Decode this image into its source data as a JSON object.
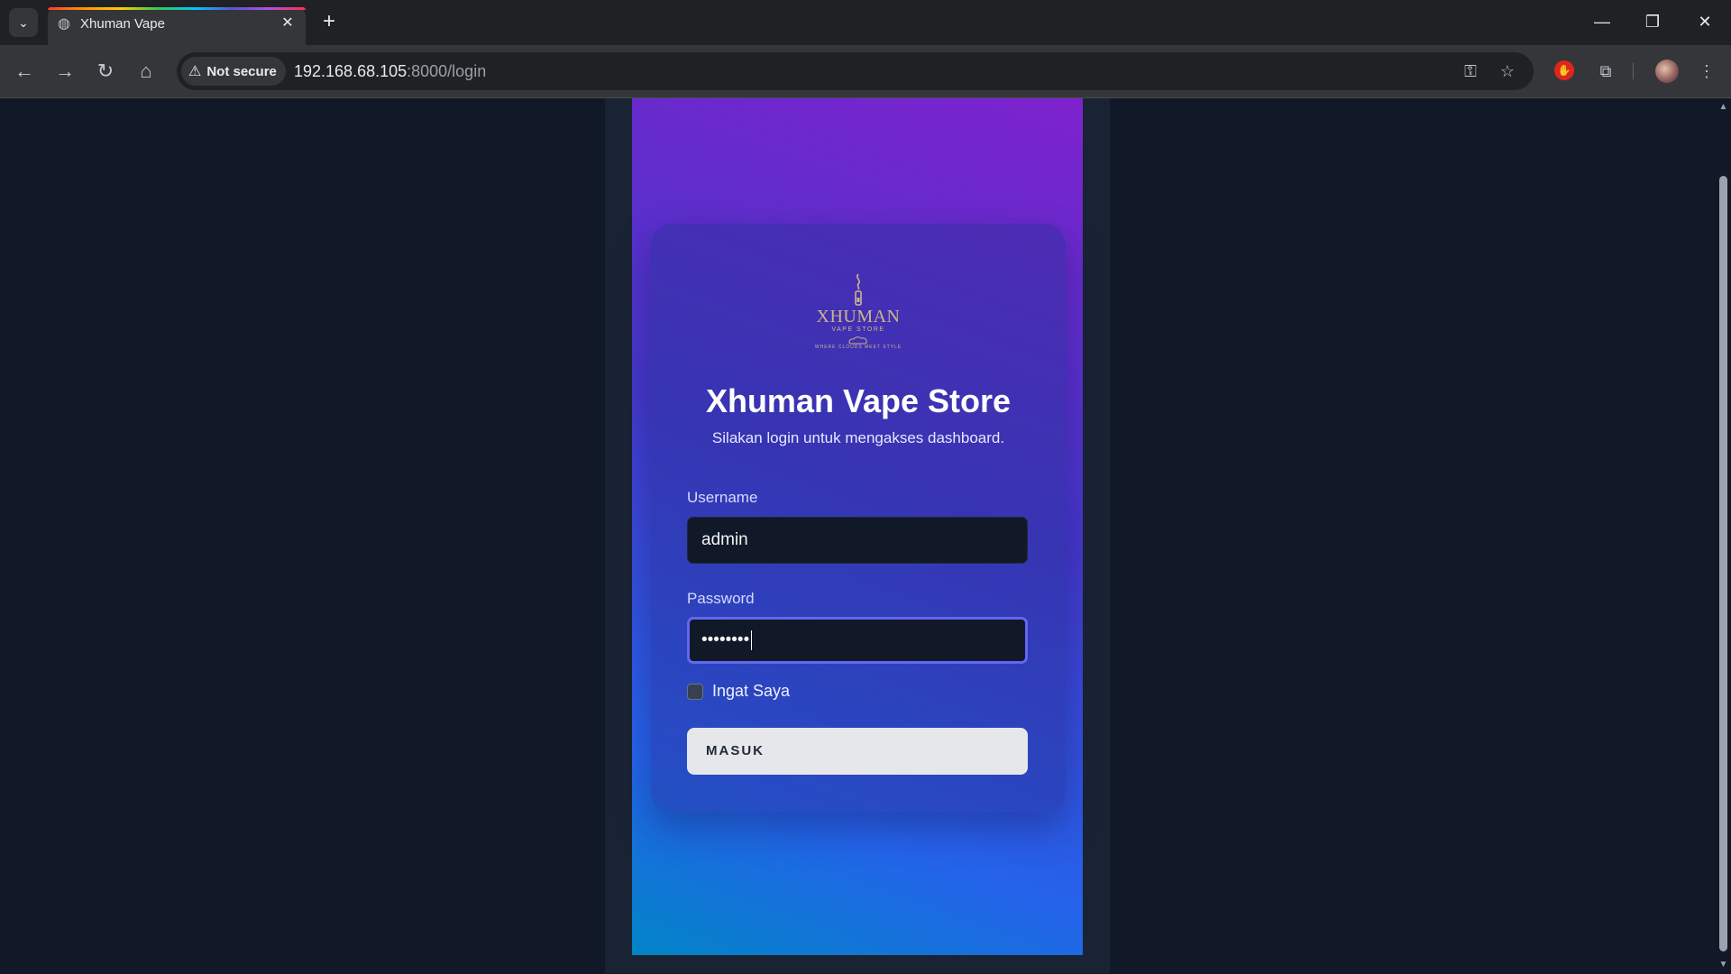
{
  "browser": {
    "tab_title": "Xhuman Vape",
    "security_label": "Not secure",
    "url_host": "192.168.68.105",
    "url_rest": ":8000/login"
  },
  "logo": {
    "brand": "XHUMAN",
    "sub": "VAPE STORE",
    "tagline": "WHERE CLOUDS MEET STYLE"
  },
  "login": {
    "title": "Xhuman Vape Store",
    "subtitle": "Silakan login untuk mengakses dashboard.",
    "username_label": "Username",
    "username_value": "admin",
    "password_label": "Password",
    "password_masked": "••••••••",
    "remember_label": "Ingat Saya",
    "submit_label": "MASUK"
  },
  "colors": {
    "accent_focus": "#6366f1",
    "gradient_top": "#7e22ce",
    "gradient_bottom": "#0284c7"
  }
}
